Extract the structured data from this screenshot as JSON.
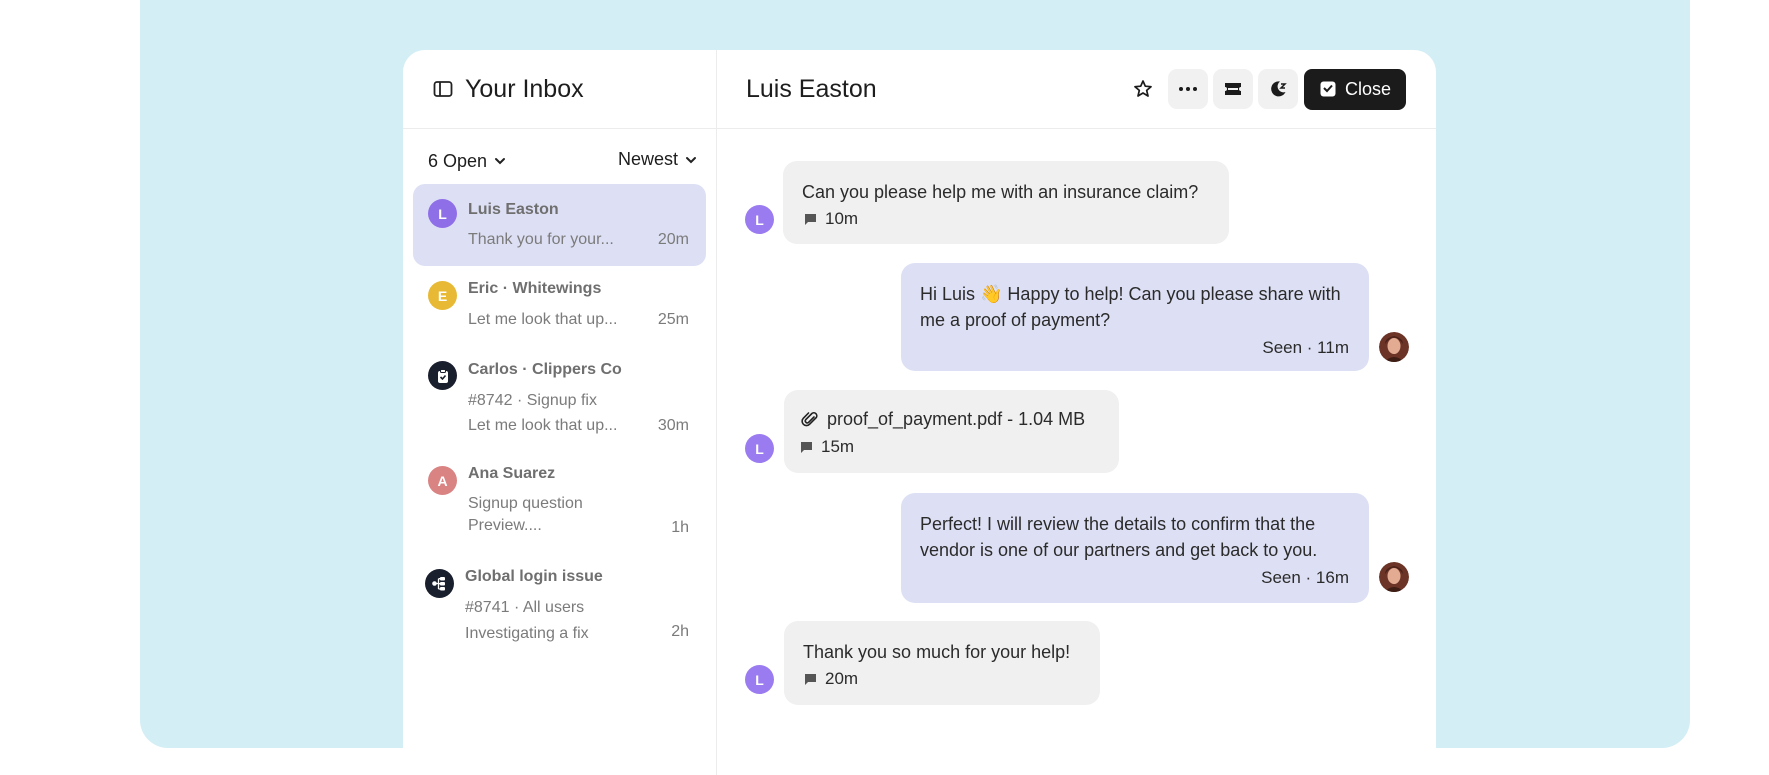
{
  "inbox": {
    "title": "Your Inbox",
    "filter_status": "6 Open",
    "filter_sort": "Newest",
    "conversations": [
      {
        "avatar": "L",
        "avatar_color": "#8f6fe8",
        "name": "Luis Easton",
        "line1": "Thank you for your...",
        "line2": "",
        "time": "20m"
      },
      {
        "avatar": "E",
        "avatar_color": "#e8b934",
        "name": "Eric · Whitewings",
        "line1": "Let me look that up...",
        "line2": "",
        "time": "25m"
      },
      {
        "avatar": "clipboard-icon",
        "avatar_color": "#1a1f2e",
        "name": "Carlos · Clippers Co",
        "line1": "#8742   · Signup fix",
        "line2": "Let me look that up...",
        "time": "30m"
      },
      {
        "avatar": "A",
        "avatar_color": "#d98383",
        "name": "Ana Suarez",
        "line1": "Signup question",
        "line2": "Preview....",
        "time": "1h"
      },
      {
        "avatar": "network-icon",
        "avatar_color": "#1a1f2e",
        "name": "Global login issue",
        "line1": "#8741 · All users",
        "line2": "Investigating a fix",
        "time": "2h"
      }
    ]
  },
  "conversation": {
    "title": "Luis Easton",
    "close_label": "Close",
    "messages": [
      {
        "dir": "in",
        "avatar": "L",
        "text": "Can you please help me with an insurance claim?",
        "meta": "10m"
      },
      {
        "dir": "out",
        "text_line1": "Hi Luis 👋 Happy to help! Can you please share with",
        "text_line2": "me a proof of payment?",
        "meta": "Seen · 11m"
      },
      {
        "dir": "in",
        "avatar": "L",
        "text": "proof_of_payment.pdf - 1.04 MB",
        "meta": "15m"
      },
      {
        "dir": "out",
        "text_line1": "Perfect! I will review the details to confirm that the",
        "text_line2": "vendor is one of our partners and get back to you.",
        "meta": "Seen · 16m"
      },
      {
        "dir": "in",
        "avatar": "L",
        "text": "Thank you so much for your help!",
        "meta": "20m"
      }
    ]
  },
  "colors": {
    "backdrop": "#d3eef5",
    "active_row": "#dde0f4",
    "customer_avatar": "#9b7cf0",
    "close_button": "#1b1b1b"
  }
}
